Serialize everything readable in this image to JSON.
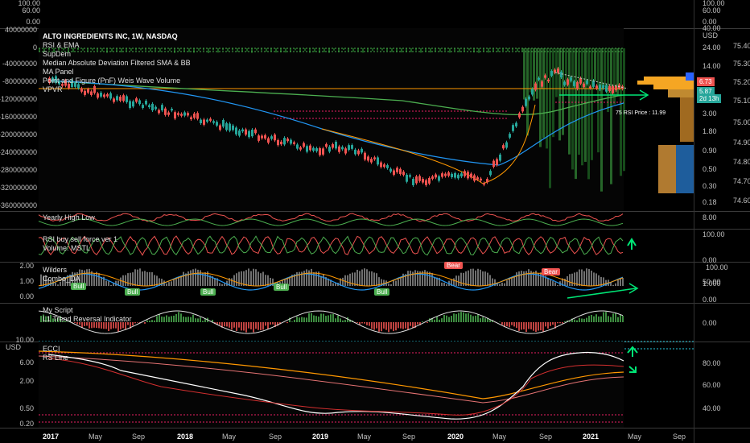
{
  "left_axis_top": [
    "100.00",
    "60.00",
    "0.00",
    "-10.00"
  ],
  "main": {
    "title": "ALTO INGREDIENTS INC, 1W, NASDAQ",
    "indicators": [
      "RSI & EMA",
      "SupDem",
      "Median Absolute Deviation Filtered SMA & BB",
      "MA Panel",
      "Point and Figure (PnF) Weis Wave Volume",
      "VPVR"
    ],
    "left_ticks": [
      "40000000",
      "0",
      "-40000000",
      "-80000000",
      "-120000000",
      "-160000000",
      "-200000000",
      "-240000000",
      "-280000000",
      "-320000000",
      "-360000000"
    ],
    "right_ticks_a": [
      "40.00",
      "24.00",
      "14.00",
      "8.00",
      "5.00",
      "3.00",
      "1.80",
      "0.90",
      "0.50",
      "0.30",
      "0.18"
    ],
    "right_ticks_b": [
      "75.40",
      "75.30",
      "75.20",
      "75.10",
      "75.00",
      "74.90",
      "74.80",
      "74.70",
      "74.60"
    ],
    "usd": "USD",
    "rsi_price": "75 RSI Price : 11.99",
    "price_tag_1": "6.73",
    "price_tag_2": "5.87",
    "price_tag_3": "2d 13h"
  },
  "pane_yearly": {
    "label": "Yearly High Low",
    "right_tick": "8.00"
  },
  "pane_rsi": {
    "label": "RSI buy sell force ver 1",
    "sublabel": "Volume: MSTL",
    "right_ticks": [
      "100.00",
      "0.00"
    ]
  },
  "pane_wilders": {
    "labels": [
      "Wilders",
      "Combo_DA"
    ],
    "left_ticks": [
      "2.00",
      "1.00",
      "0.00"
    ],
    "right_ticks": [
      "100.00",
      "1.000",
      "50.00",
      "0.500",
      "0.00"
    ],
    "bull": "Bull",
    "bear": "Bear"
  },
  "pane_script": {
    "labels": [
      "My Script",
      "L1 Trend Reversal Indicator"
    ],
    "right_tick": "0.00"
  },
  "pane_ecci": {
    "labels": [
      "ECCI",
      "RS Line"
    ],
    "left_ticks": [
      "10.00",
      "USD",
      "6.00",
      "2.00",
      "0.50",
      "0.20"
    ],
    "right_ticks": [
      "80.00",
      "60.00",
      "40.00"
    ]
  },
  "x_axis": [
    "2017",
    "May",
    "Sep",
    "2018",
    "May",
    "Sep",
    "2019",
    "May",
    "Sep",
    "2020",
    "May",
    "Sep",
    "2021",
    "May",
    "Sep"
  ],
  "colors": {
    "up": "#26a69a",
    "down": "#ef5350",
    "arrow": "#00e676",
    "orange": "#ff9800",
    "blue": "#2196f3"
  }
}
